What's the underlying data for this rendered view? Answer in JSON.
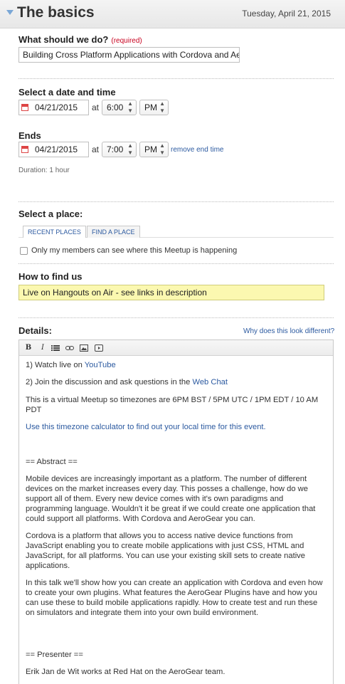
{
  "header": {
    "title": "The basics",
    "date": "Tuesday, April 21, 2015"
  },
  "what": {
    "label": "What should we do?",
    "required": "(required)",
    "value": "Building Cross Platform Applications with Cordova and Ae"
  },
  "start": {
    "label": "Select a date and time",
    "date": "04/21/2015",
    "at": "at",
    "time": "6:00",
    "ampm": "PM"
  },
  "end": {
    "label": "Ends",
    "date": "04/21/2015",
    "at": "at",
    "time": "7:00",
    "ampm": "PM",
    "remove": "remove end time",
    "duration": "Duration: 1 hour"
  },
  "place": {
    "label": "Select a place:",
    "tabs": [
      "RECENT PLACES",
      "FIND A PLACE"
    ],
    "members_only": "Only my members can see where this Meetup is happening"
  },
  "howto": {
    "label": "How to find us",
    "value": "Live on Hangouts on Air - see links in description"
  },
  "details": {
    "label": "Details:",
    "why": "Why does this look different?",
    "toolbar": {
      "bold": "B",
      "italic": "I"
    },
    "p1_text": "1) Watch live on ",
    "p1_link": "YouTube",
    "p2_text": "2) Join the discussion and ask questions in the ",
    "p2_link": "Web Chat",
    "p3": "This is a virtual Meetup so timezones are 6PM BST / 5PM UTC / 1PM EDT / 10 AM PDT",
    "p4_link": "Use this timezone calculator to find out your local time for this event.",
    "abstract_heading": "== Abstract ==",
    "abstract_1": "Mobile devices are increasingly important as a platform. The number of different devices on the market increases every day. This posses a challenge, how do we support all of them. Every new device comes with it's own paradigms and programming language. Wouldn't it be great if we could create one application that could support all platforms. With Cordova and AeroGear you can.",
    "abstract_2": "Cordova is a platform that allows you to access native device functions from JavaScript enabling you to create mobile applications with just CSS, HTML and JavaScript, for all platforms. You can use your existing skill sets to create native applications.",
    "abstract_3": "In this talk we'll show how you can create an application with Cordova and even how to create your own plugins. What features the AeroGear Plugins have and how you can use these to build mobile applications rapidly. How to create test and run these on simulators and integrate them into your own build environment.",
    "presenter_heading": "== Presenter ==",
    "presenter_1": "Erik Jan de Wit works at Red Hat on the AeroGear team."
  }
}
